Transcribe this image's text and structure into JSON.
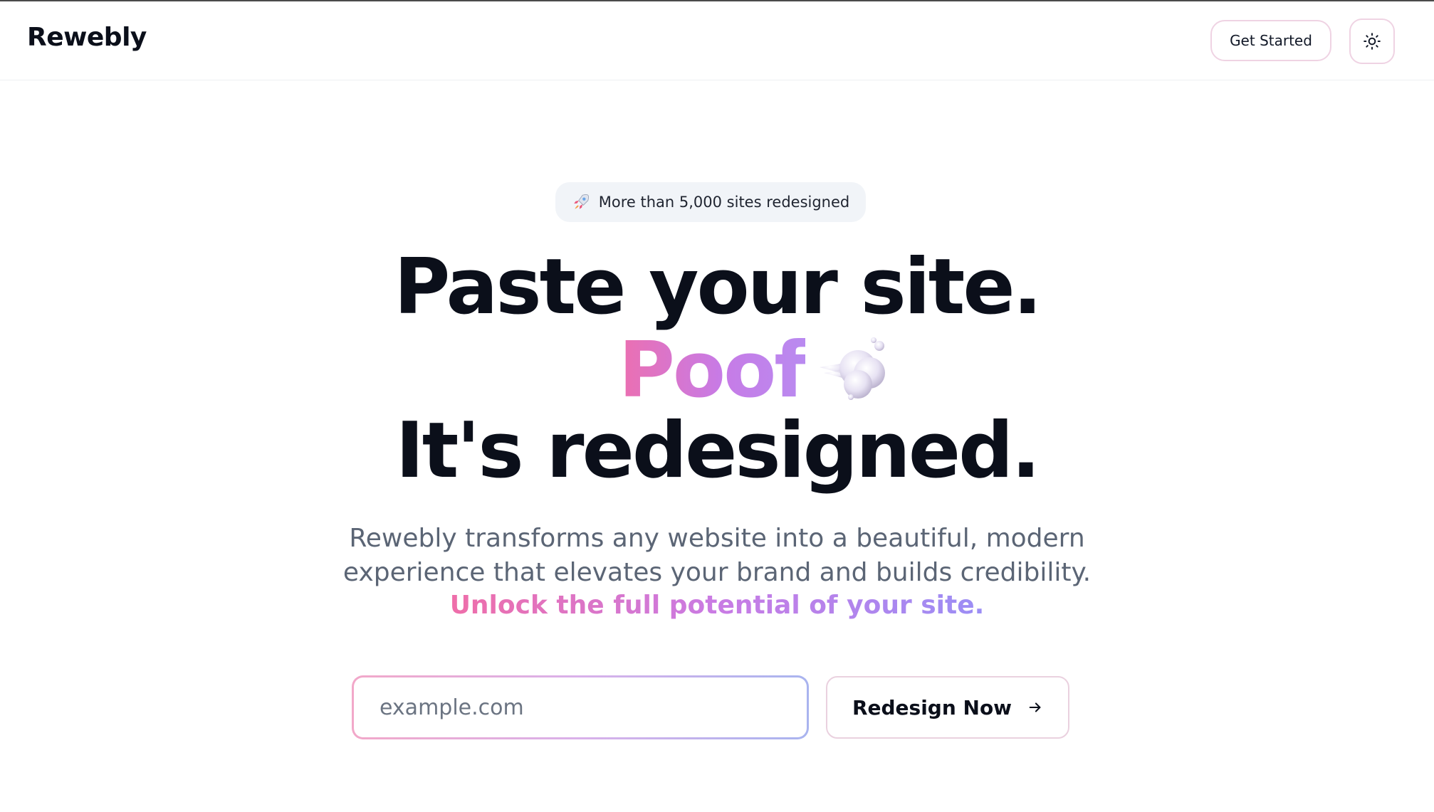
{
  "header": {
    "logo": "Rewebly",
    "get_started_label": "Get Started",
    "theme_toggle_icon": "sun-icon"
  },
  "hero": {
    "badge_icon": "rocket-icon",
    "badge_text": "More than 5,000 sites redesigned",
    "headline_line1": "Paste your site.",
    "headline_line2": "Poof",
    "headline_line2_icon": "cloud-poof-icon",
    "headline_line3": "It's redesigned.",
    "subtitle_line1": "Rewebly transforms any website into a beautiful, modern",
    "subtitle_line2": "experience that elevates your brand and builds credibility.",
    "tagline": "Unlock the full potential of your site."
  },
  "form": {
    "url_placeholder": "example.com",
    "url_value": "",
    "submit_label": "Redesign Now",
    "submit_icon": "arrow-right-icon"
  },
  "colors": {
    "text_dark": "#0b0f1a",
    "text_muted": "#5b6575",
    "gradient_pink": "#ec6fb0",
    "gradient_purple": "#c77be6",
    "gradient_blue": "#9b8ef5",
    "badge_bg": "#f1f4f8"
  }
}
